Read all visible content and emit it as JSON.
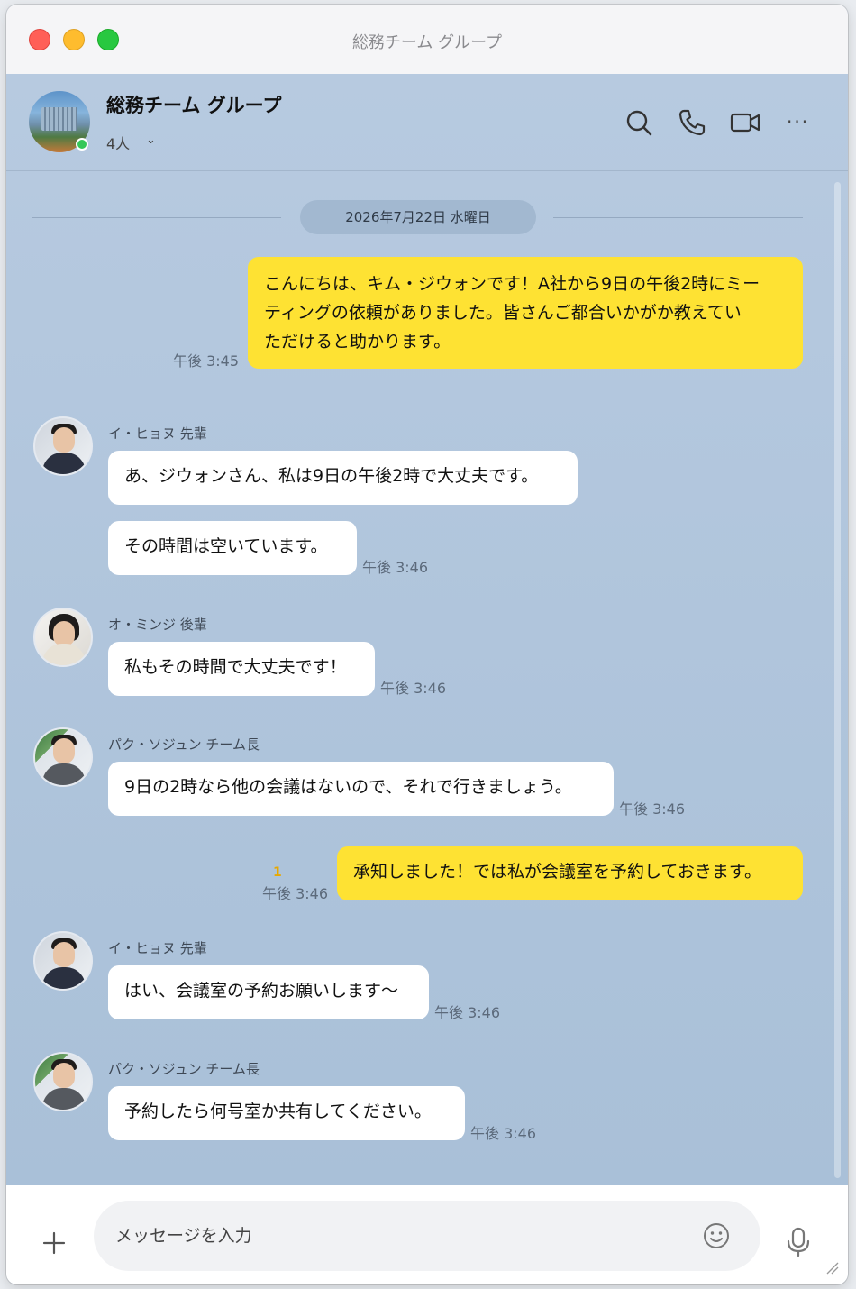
{
  "window": {
    "title": "総務チーム グループ"
  },
  "header": {
    "group_name": "総務チーム グループ",
    "member_count": "4人",
    "member_chevron": "⌄",
    "icons": [
      "search-icon",
      "phone-icon",
      "video-icon",
      "more-icon"
    ],
    "more_glyph": "···"
  },
  "date_divider": "2026年7月22日 水曜日",
  "messages": [
    {
      "from": "me",
      "lines": [
        "こんにちは、キム・ジウォンです！A社から9日の午後2時にミー",
        "ティングの依頼がありました。皆さんご都合いかがか教えてい",
        "ただけると助かります。"
      ],
      "time": "午後 3:45"
    },
    {
      "from": "イ・ヒョヌ 先輩",
      "bubbles": [
        "あ、ジウォンさん、私は9日の午後2時で大丈夫です。",
        "その時間は空いています。"
      ],
      "time": "午後 3:46"
    },
    {
      "from": "オ・ミンジ 後輩",
      "bubbles": [
        "私もその時間で大丈夫です！"
      ],
      "time": "午後 3:46"
    },
    {
      "from": "パク・ソジュン チーム長",
      "bubbles": [
        "9日の2時なら他の会議はないので、それで行きましょう。"
      ],
      "time": "午後 3:46"
    },
    {
      "from": "me",
      "text": "承知しました！では私が会議室を予約しておきます。",
      "unread": "1",
      "time": "午後 3:46"
    },
    {
      "from": "イ・ヒョヌ 先輩",
      "bubbles": [
        "はい、会議室の予約お願いします～"
      ],
      "time": "午後 3:46"
    },
    {
      "from": "パク・ソジュン チーム長",
      "bubbles": [
        "予約したら何号室か共有してください。"
      ],
      "time": "午後 3:46"
    }
  ],
  "input": {
    "placeholder": "メッセージを入力",
    "value": ""
  },
  "colors": {
    "my_bubble": "#fee233",
    "their_bubble": "#ffffff",
    "chat_bg": "#b6c9df",
    "online": "#35c759"
  }
}
